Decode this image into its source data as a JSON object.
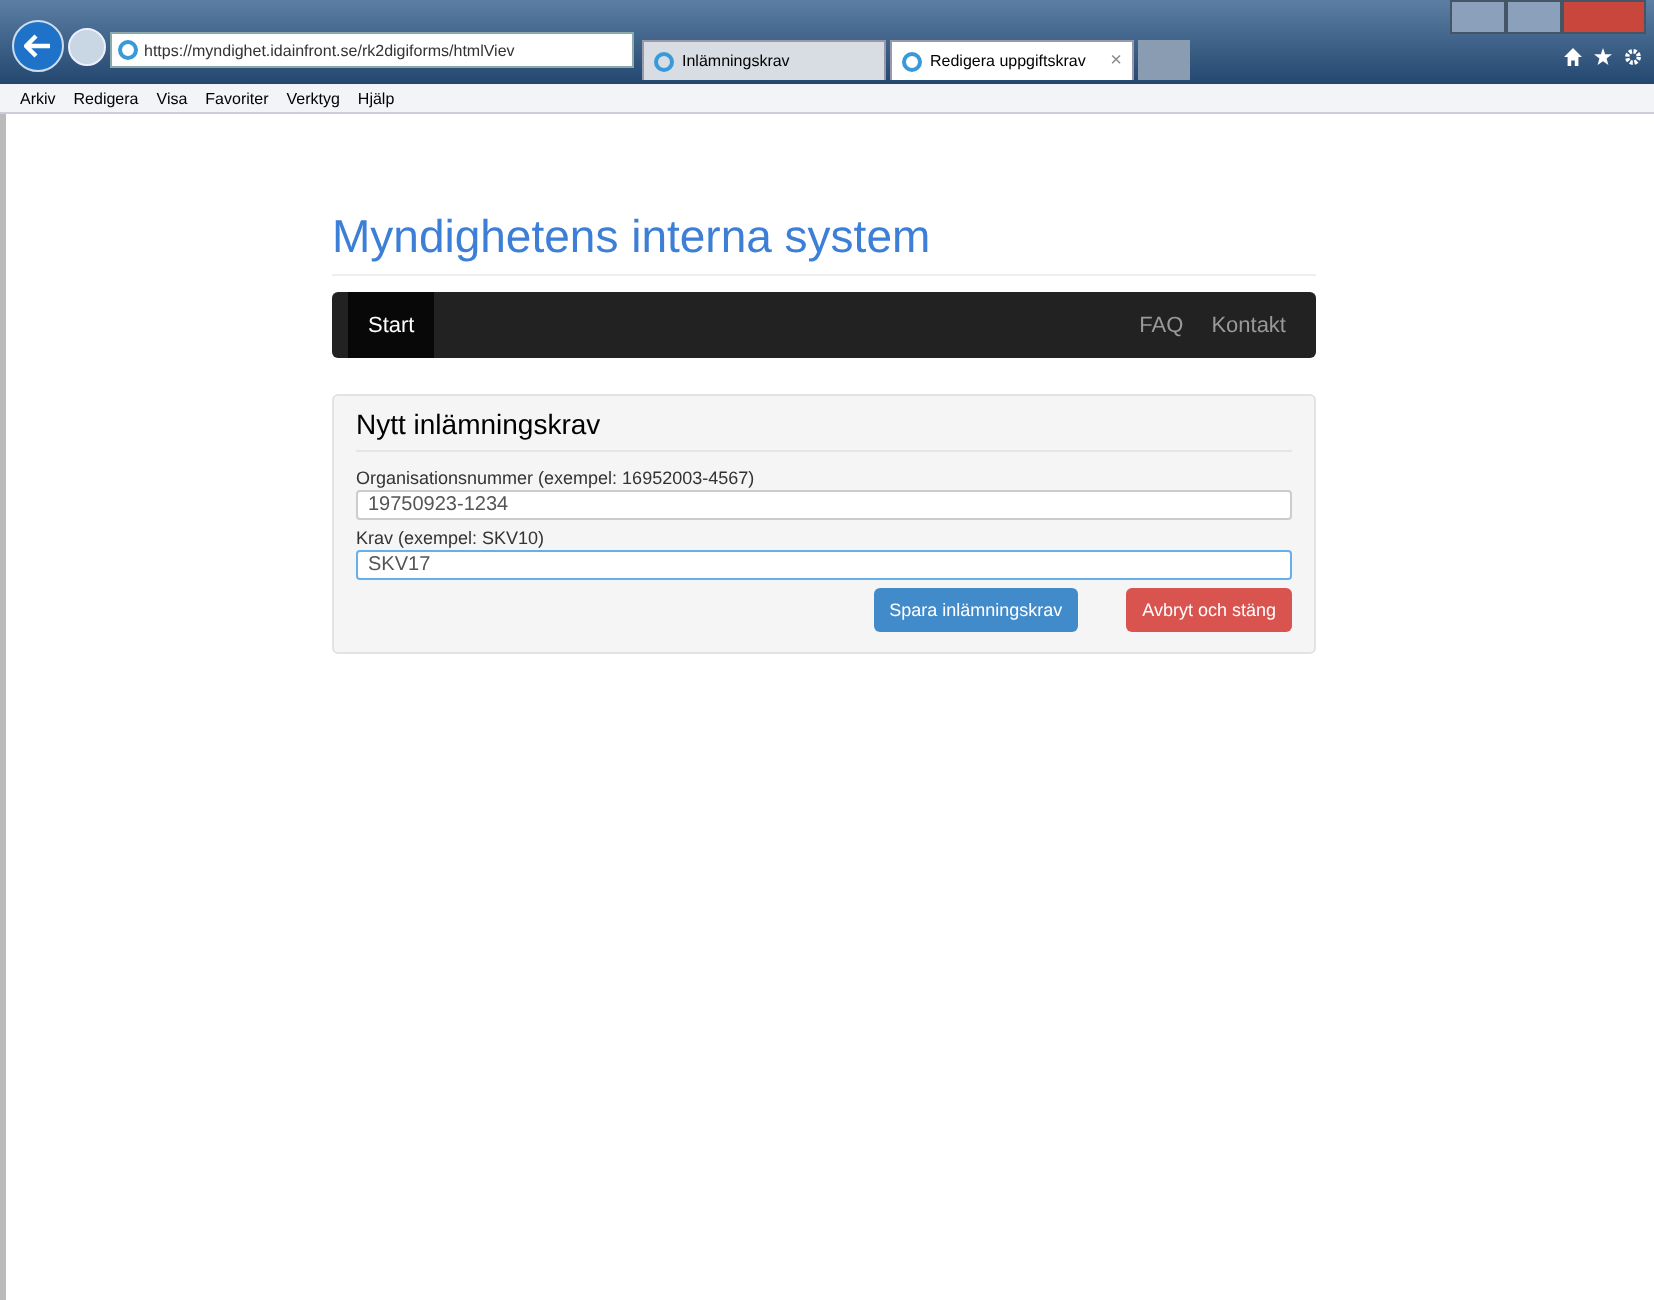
{
  "browser": {
    "address": "https://myndighet.idainfront.se/rk2digiforms/htmlViev",
    "tabs": [
      {
        "label": "Inlämningskrav",
        "selected": false
      },
      {
        "label": "Redigera uppgiftskrav",
        "selected": true,
        "close": "×"
      }
    ],
    "menu": [
      "Arkiv",
      "Redigera",
      "Visa",
      "Favoriter",
      "Verktyg",
      "Hjälp"
    ]
  },
  "page": {
    "title": "Myndighetens interna system",
    "nav_left": [
      {
        "label": "Start",
        "selected": true
      }
    ],
    "nav_right": [
      {
        "label": "FAQ",
        "selected": false
      },
      {
        "label": "Kontakt",
        "selected": false
      }
    ],
    "panel": {
      "heading": "Nytt inlämningskrav",
      "fields": [
        {
          "label": "Organisationsnummer (exempel: 16952003-4567)",
          "value": "19750923-1234",
          "focused": false
        },
        {
          "label": "Krav (exempel: SKV10)",
          "value": "SKV17",
          "focused": true
        }
      ],
      "buttons": [
        {
          "label": "Spara inlämningskrav",
          "kind": "primary"
        },
        {
          "label": "Avbryt och stäng",
          "kind": "danger"
        }
      ]
    }
  }
}
